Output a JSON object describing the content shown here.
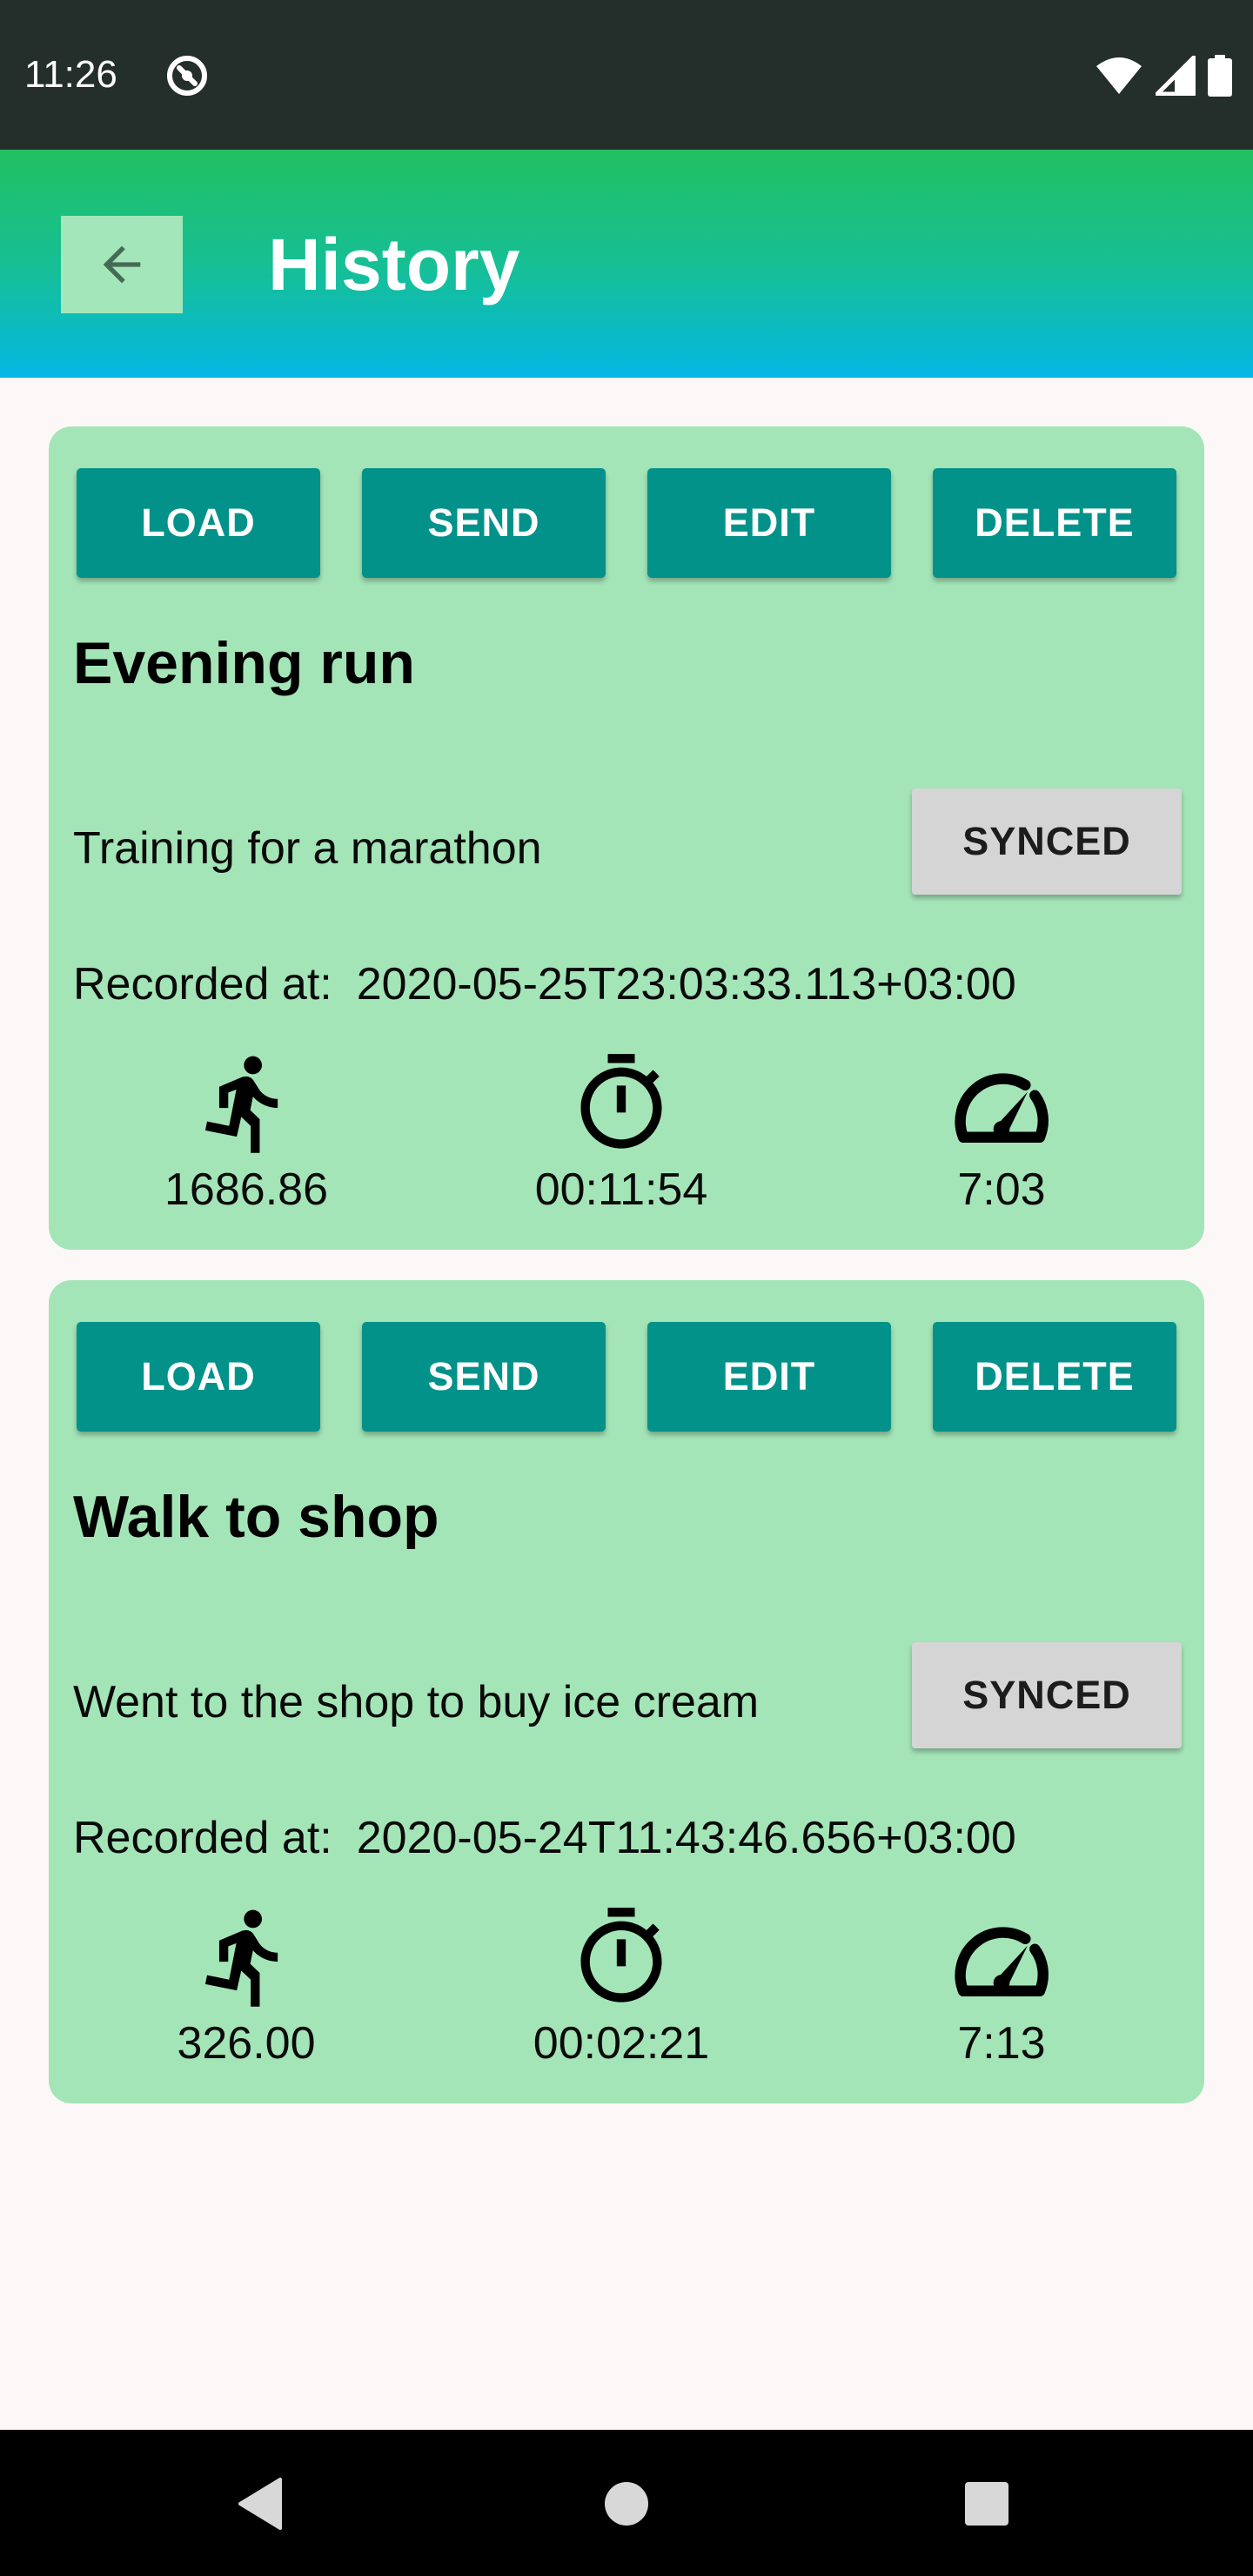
{
  "status_bar": {
    "time": "11:26"
  },
  "app_bar": {
    "title": "History"
  },
  "labels": {
    "load": "LOAD",
    "send": "SEND",
    "edit": "EDIT",
    "delete": "DELETE",
    "recorded_at": "Recorded at:"
  },
  "records": [
    {
      "title": "Evening run",
      "description": "Training for a marathon",
      "sync_status": "SYNCED",
      "recorded_at": "2020-05-25T23:03:33.113+03:00",
      "distance": "1686.86",
      "duration": "00:11:54",
      "pace": "7:03"
    },
    {
      "title": "Walk to shop",
      "description": "Went to the shop to buy ice cream",
      "sync_status": "SYNCED",
      "recorded_at": "2020-05-24T11:43:46.656+03:00",
      "distance": "326.00",
      "duration": "00:02:21",
      "pace": "7:13"
    }
  ],
  "icons": {
    "back": "arrow-back-icon",
    "distance": "directions-run-icon",
    "duration": "stopwatch-icon",
    "pace": "speedometer-icon",
    "nav_back": "triangle-back-icon",
    "nav_home": "circle-home-icon",
    "nav_recents": "square-recents-icon"
  },
  "colors": {
    "status_bar": "#242e2a",
    "app_bar_top": "#21c061",
    "app_bar_bottom": "#04b7e4",
    "card_background": "#a4e5b8",
    "action_button": "#02928a",
    "sync_button": "#d5d5d5",
    "page_background": "#fcf8f7"
  }
}
